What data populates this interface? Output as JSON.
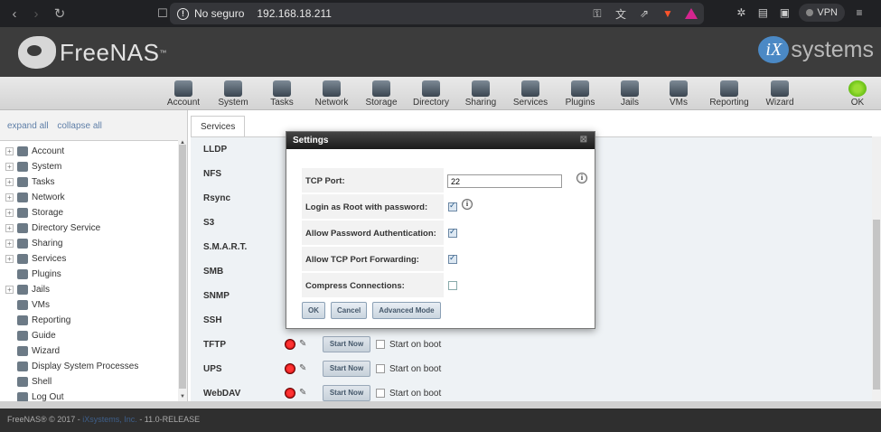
{
  "browser": {
    "insecure_label": "No seguro",
    "url": "192.168.18.211",
    "vpn_label": "VPN",
    "warn_glyph": "!"
  },
  "header": {
    "logo_text": "FreeNAS",
    "logo_tm": "™",
    "ix_mark": "iX",
    "ix_text": "systems"
  },
  "toolbar": [
    {
      "label": "Account"
    },
    {
      "label": "System"
    },
    {
      "label": "Tasks"
    },
    {
      "label": "Network"
    },
    {
      "label": "Storage"
    },
    {
      "label": "Directory"
    },
    {
      "label": "Sharing"
    },
    {
      "label": "Services"
    },
    {
      "label": "Plugins"
    },
    {
      "label": "Jails"
    },
    {
      "label": "VMs"
    },
    {
      "label": "Reporting"
    },
    {
      "label": "Wizard"
    },
    {
      "label": "OK"
    }
  ],
  "sidebar": {
    "expand_all": "expand all",
    "collapse_all": "collapse all",
    "items": [
      {
        "label": "Account",
        "expandable": true
      },
      {
        "label": "System",
        "expandable": true
      },
      {
        "label": "Tasks",
        "expandable": true
      },
      {
        "label": "Network",
        "expandable": true
      },
      {
        "label": "Storage",
        "expandable": true
      },
      {
        "label": "Directory Service",
        "expandable": true
      },
      {
        "label": "Sharing",
        "expandable": true
      },
      {
        "label": "Services",
        "expandable": true
      },
      {
        "label": "Plugins",
        "expandable": false
      },
      {
        "label": "Jails",
        "expandable": true
      },
      {
        "label": "VMs",
        "expandable": false
      },
      {
        "label": "Reporting",
        "expandable": false
      },
      {
        "label": "Guide",
        "expandable": false
      },
      {
        "label": "Wizard",
        "expandable": false
      },
      {
        "label": "Display System Processes",
        "expandable": false
      },
      {
        "label": "Shell",
        "expandable": false
      },
      {
        "label": "Log Out",
        "expandable": false
      }
    ]
  },
  "main": {
    "tab_label": "Services",
    "services": [
      {
        "name": "LLDP",
        "controls_visible": false
      },
      {
        "name": "NFS",
        "controls_visible": false
      },
      {
        "name": "Rsync",
        "controls_visible": false
      },
      {
        "name": "S3",
        "controls_visible": false
      },
      {
        "name": "S.M.A.R.T.",
        "controls_visible": false
      },
      {
        "name": "SMB",
        "controls_visible": false
      },
      {
        "name": "SNMP",
        "controls_visible": false
      },
      {
        "name": "SSH",
        "controls_visible": false
      },
      {
        "name": "TFTP",
        "controls_visible": true,
        "start_label": "Start Now",
        "boot_label": "Start on boot"
      },
      {
        "name": "UPS",
        "controls_visible": true,
        "start_label": "Start Now",
        "boot_label": "Start on boot"
      },
      {
        "name": "WebDAV",
        "controls_visible": true,
        "start_label": "Start Now",
        "boot_label": "Start on boot"
      }
    ]
  },
  "dialog": {
    "title": "Settings",
    "close_glyph": "⊠",
    "tcp_port_label": "TCP Port:",
    "tcp_port_value": "22",
    "login_root_label": "Login as Root with password:",
    "login_root_checked": true,
    "allow_pw_label": "Allow Password Authentication:",
    "allow_pw_checked": true,
    "allow_fwd_label": "Allow TCP Port Forwarding:",
    "allow_fwd_checked": true,
    "compress_label": "Compress Connections:",
    "compress_checked": false,
    "info_glyph": "i",
    "ok_label": "OK",
    "cancel_label": "Cancel",
    "advanced_label": "Advanced Mode"
  },
  "footer": {
    "copyright": "FreeNAS® © 2017 - ",
    "company": "iXsystems, Inc.",
    "version": " - 11.0-RELEASE"
  }
}
